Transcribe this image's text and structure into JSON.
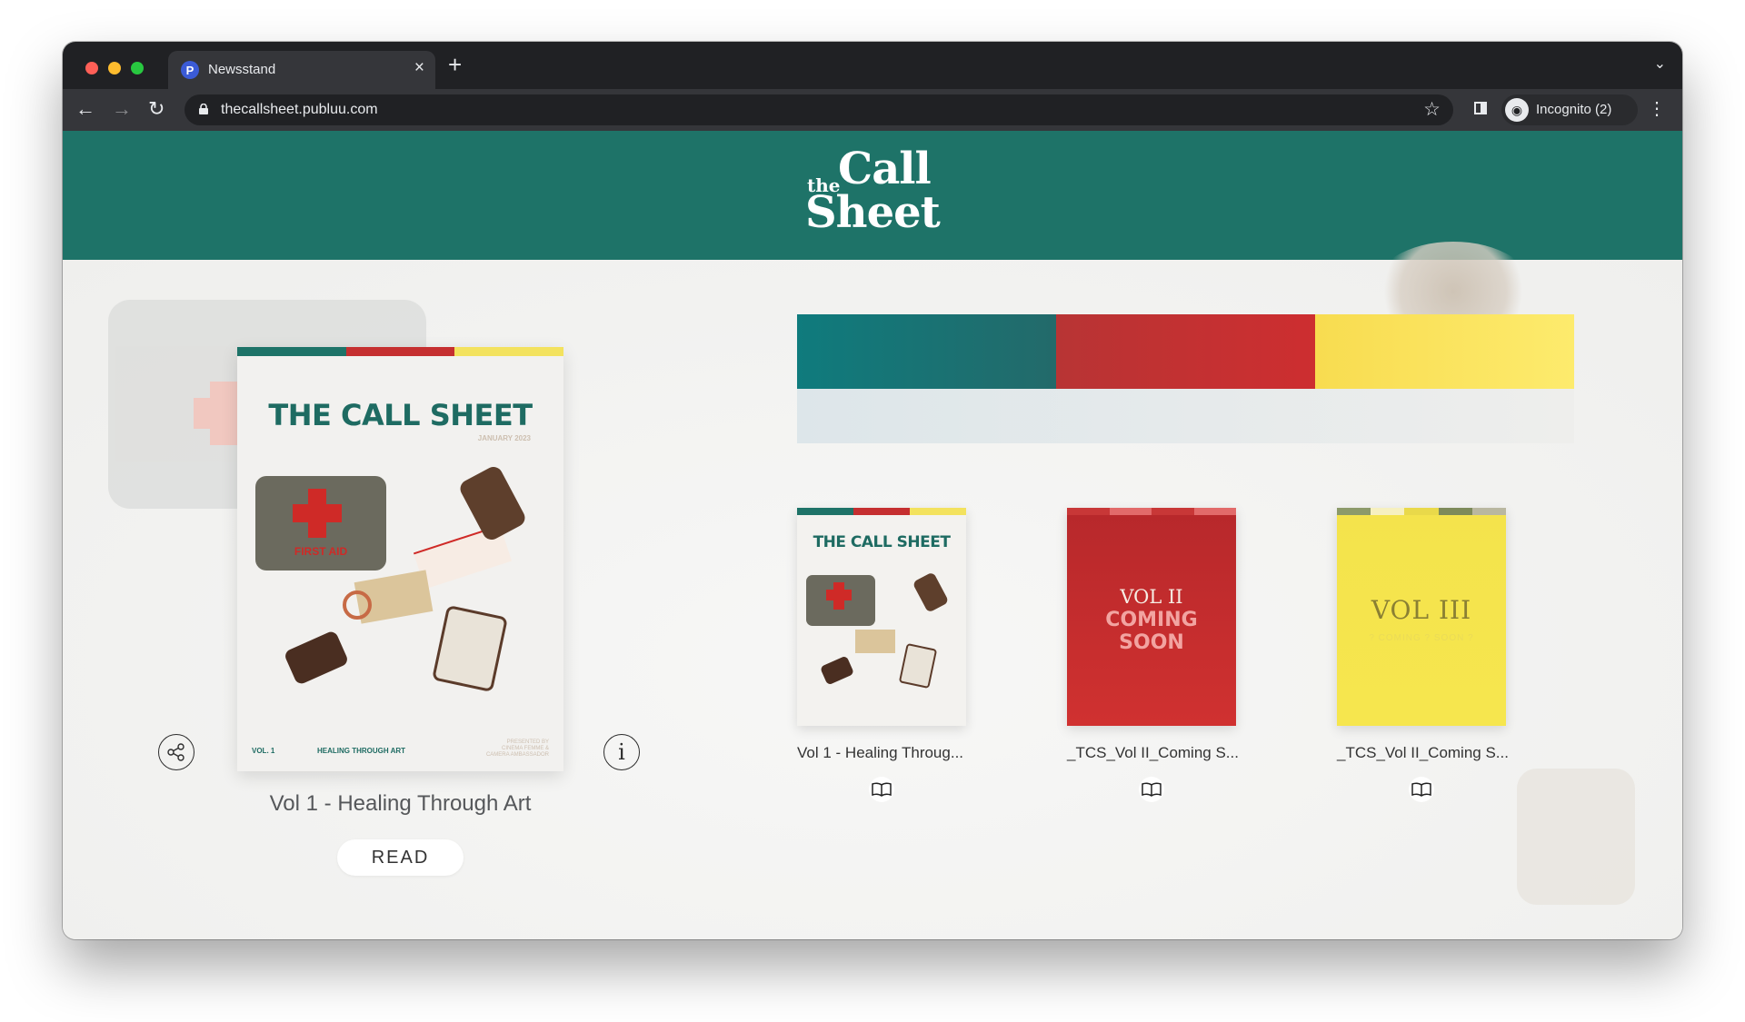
{
  "browser": {
    "tab_title": "Newsstand",
    "tab_favicon_letter": "P",
    "url": "thecallsheet.publuu.com",
    "incognito_label": "Incognito (2)",
    "icons": [
      "back-icon",
      "forward-icon",
      "reload-icon",
      "lock-icon",
      "star-icon",
      "side-panel-icon",
      "incognito-icon",
      "menu-icon",
      "new-tab-icon",
      "close-icon",
      "chevron-down-icon"
    ]
  },
  "header": {
    "logo": {
      "the": "the",
      "call": "Call",
      "sheet": "Sheet"
    },
    "background_color": "#1e7368"
  },
  "featured": {
    "cover": {
      "heading": "THE CALL SHEET",
      "date": "JANUARY 2023",
      "tin_label": "FIRST AID",
      "vol": "VOL. 1",
      "tagline": "HEALING THROUGH ART",
      "presented": "PRESENTED BY CINEMA FEMME & CAMERA AMBASSADOR"
    },
    "title": "Vol 1 - Healing Through Art",
    "read_label": "READ",
    "share_icon": "share-icon",
    "info_icon": "info-icon",
    "info_glyph": "i"
  },
  "palette": {
    "teal": "#14797a",
    "red": "#c52f30",
    "yellow": "#fbe35a"
  },
  "issues": [
    {
      "title": "Vol 1 - Healing Throug...",
      "cover_heading": "THE CALL SHEET"
    },
    {
      "title": "_TCS_Vol II_Coming S...",
      "cover_line1": "VOL II",
      "cover_line2": "COMING",
      "cover_line3": "SOON"
    },
    {
      "title": "_TCS_Vol II_Coming S...",
      "cover_line1": "VOL III",
      "cover_line2": "? COMING ? SOON ?"
    }
  ]
}
